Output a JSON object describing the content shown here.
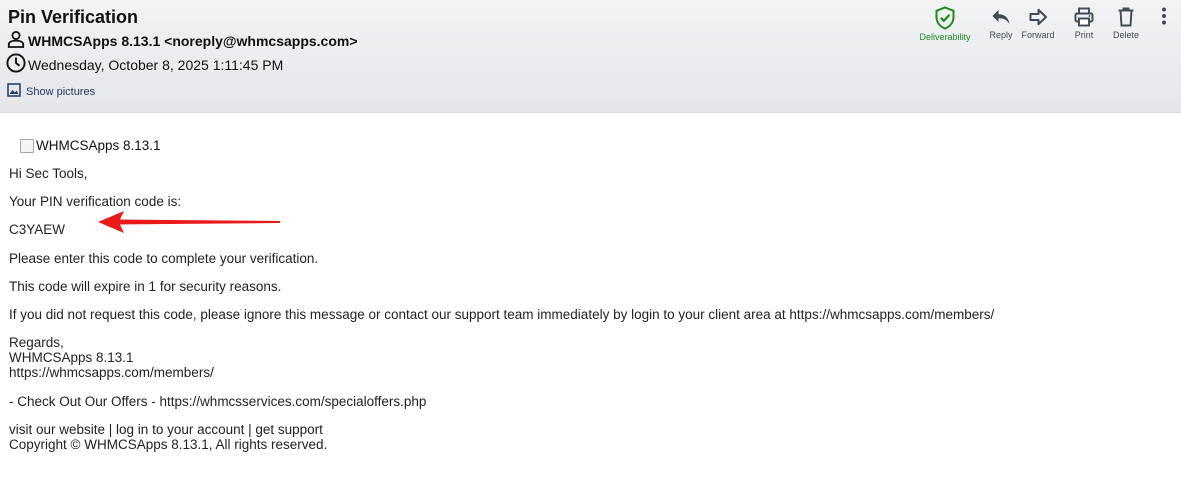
{
  "email": {
    "subject": "Pin Verification",
    "from": "WHMCSApps 8.13.1 <noreply@whmcsapps.com>",
    "date": "Wednesday, October 8, 2025 1:11:45 PM",
    "show_pictures": "Show pictures"
  },
  "toolbar": {
    "deliverability": "Deliverability",
    "reply": "Reply",
    "forward": "Forward",
    "print": "Print",
    "delete": "Delete"
  },
  "body": {
    "logo_alt": "WHMCSApps 8.13.1",
    "greeting": "Hi Sec Tools,",
    "intro": "Your PIN verification code is:",
    "code": "C3YAEW",
    "instruction": "Please enter this code to complete your verification.",
    "expiry": "This code will expire in 1 for security reasons.",
    "notice": "If you did not request this code, please ignore this message or contact our support team immediately by login to your client area at https://whmcsapps.com/members/",
    "regards": "Regards,",
    "signature_name": "WHMCSApps 8.13.1",
    "signature_url": "https://whmcsapps.com/members/",
    "offers": "- Check Out Our Offers - https://whmcsservices.com/specialoffers.php",
    "footer_links": "visit our website | log in to your account | get support",
    "copyright": "Copyright © WHMCSApps 8.13.1, All rights reserved."
  },
  "colors": {
    "deliverability_green": "#1e8a1e",
    "annotation_arrow": "#e81a1a",
    "header_bg": "#e8e9ec"
  }
}
